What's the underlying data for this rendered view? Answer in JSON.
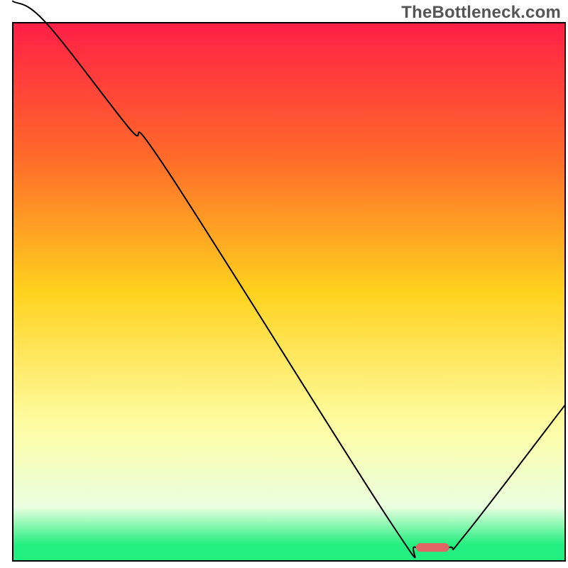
{
  "watermark": "TheBottleneck.com",
  "chart_data": {
    "type": "line",
    "title": "",
    "xlabel": "",
    "ylabel": "",
    "xlim": [
      0,
      100
    ],
    "ylim": [
      0,
      100
    ],
    "axes_visible": false,
    "background_gradient": {
      "direction": "vertical",
      "stops": [
        {
          "offset": 0.0,
          "color": "#ff1f47"
        },
        {
          "offset": 0.25,
          "color": "#ff6a2a"
        },
        {
          "offset": 0.5,
          "color": "#ffd21e"
        },
        {
          "offset": 0.74,
          "color": "#fffca0"
        },
        {
          "offset": 0.9,
          "color": "#eaffe0"
        },
        {
          "offset": 0.97,
          "color": "#22ef7f"
        },
        {
          "offset": 1.0,
          "color": "#22ef7f"
        }
      ]
    },
    "series": [
      {
        "name": "bottleneck-curve",
        "color": "#000000",
        "width": 2,
        "x": [
          0.0,
          6.0,
          21.0,
          28.0,
          68.0,
          73.0,
          79.0,
          82.0,
          100.0
        ],
        "y": [
          104.0,
          100.0,
          80.5,
          72.5,
          7.8,
          2.5,
          2.5,
          5.0,
          29.0
        ]
      }
    ],
    "marker": {
      "name": "optimal-range-marker",
      "color": "#e06666",
      "x_start": 73.0,
      "x_end": 79.0,
      "y": 2.5,
      "thickness": 1.6
    }
  }
}
